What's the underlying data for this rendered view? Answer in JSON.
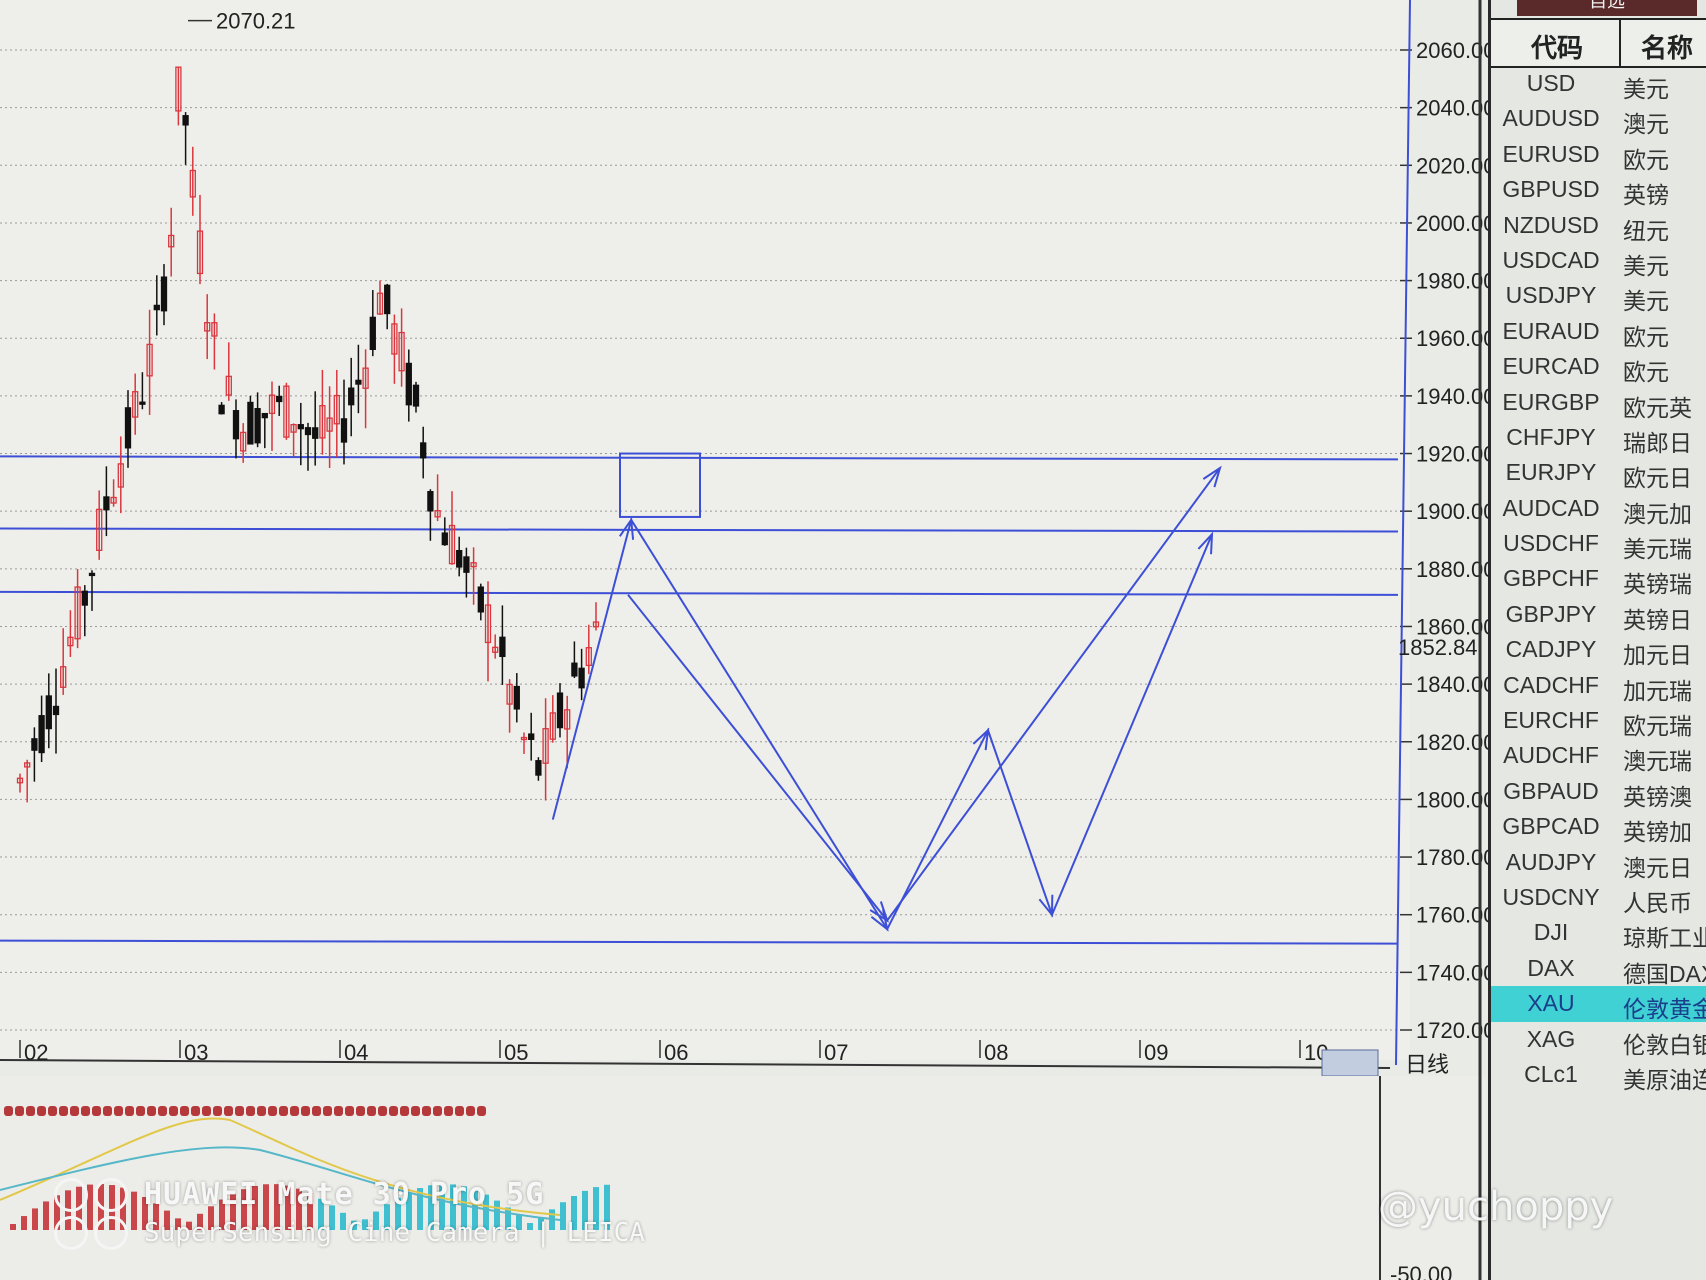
{
  "chart": {
    "peak_label": "2070.21",
    "current_price": "1852.84",
    "period_label": "日线",
    "colors": {
      "up": "#d9363e",
      "down": "#111111",
      "lines": "#3d4fd6",
      "price": "#e07070"
    }
  },
  "chart_data": {
    "type": "candlestick",
    "y_ticks": [
      "2060.00",
      "2040.00",
      "2020.00",
      "2000.00",
      "1980.00",
      "1960.00",
      "1940.00",
      "1920.00",
      "1900.00",
      "1880.00",
      "1860.00",
      "1840.00",
      "1820.00",
      "1800.00",
      "1780.00",
      "1760.00",
      "1740.00",
      "1720.00"
    ],
    "x_ticks": [
      "02",
      "03",
      "04",
      "05",
      "06",
      "07",
      "08",
      "09",
      "10"
    ],
    "ylim": [
      1720,
      2060
    ],
    "horizontal_levels": [
      1919,
      1894,
      1872,
      1751
    ],
    "peak": 2070.21,
    "current": 1852.84,
    "forecast_path_a": [
      [
        5.33,
        1793
      ],
      [
        5.82,
        1897
      ],
      [
        7.42,
        1755
      ],
      [
        8.05,
        1824
      ],
      [
        8.45,
        1760
      ],
      [
        9.45,
        1892
      ]
    ],
    "forecast_path_b": [
      [
        5.8,
        1871
      ],
      [
        7.42,
        1758
      ],
      [
        9.5,
        1915
      ]
    ],
    "target_box": {
      "x": [
        5.75,
        6.25
      ],
      "y": [
        1898,
        1920
      ]
    },
    "lower_indicator_value": "-50.00"
  },
  "watchlist": {
    "tab": "自选",
    "headers": {
      "code": "代码",
      "name": "名称"
    },
    "rows": [
      {
        "code": "USD",
        "name": "美元"
      },
      {
        "code": "AUDUSD",
        "name": "澳元"
      },
      {
        "code": "EURUSD",
        "name": "欧元"
      },
      {
        "code": "GBPUSD",
        "name": "英镑"
      },
      {
        "code": "NZDUSD",
        "name": "纽元"
      },
      {
        "code": "USDCAD",
        "name": "美元"
      },
      {
        "code": "USDJPY",
        "name": "美元"
      },
      {
        "code": "EURAUD",
        "name": "欧元"
      },
      {
        "code": "EURCAD",
        "name": "欧元"
      },
      {
        "code": "EURGBP",
        "name": "欧元英"
      },
      {
        "code": "CHFJPY",
        "name": "瑞郎日"
      },
      {
        "code": "EURJPY",
        "name": "欧元日"
      },
      {
        "code": "AUDCAD",
        "name": "澳元加"
      },
      {
        "code": "USDCHF",
        "name": "美元瑞"
      },
      {
        "code": "GBPCHF",
        "name": "英镑瑞"
      },
      {
        "code": "GBPJPY",
        "name": "英镑日"
      },
      {
        "code": "CADJPY",
        "name": "加元日"
      },
      {
        "code": "CADCHF",
        "name": "加元瑞"
      },
      {
        "code": "EURCHF",
        "name": "欧元瑞"
      },
      {
        "code": "AUDCHF",
        "name": "澳元瑞"
      },
      {
        "code": "GBPAUD",
        "name": "英镑澳"
      },
      {
        "code": "GBPCAD",
        "name": "英镑加"
      },
      {
        "code": "AUDJPY",
        "name": "澳元日"
      },
      {
        "code": "USDCNY",
        "name": "人民币"
      },
      {
        "code": "DJI",
        "name": "琼斯工业"
      },
      {
        "code": "DAX",
        "name": "德国DAX"
      },
      {
        "code": "XAU",
        "name": "伦敦黄金",
        "selected": true
      },
      {
        "code": "XAG",
        "name": "伦敦白银"
      },
      {
        "code": "CLc1",
        "name": "美原油连"
      }
    ]
  },
  "watermark": {
    "line1": "HUAWEI Mate 30 Pro 5G",
    "line2": "SuperSensing Cine Camera | LEICA",
    "signature": "@yuchoppy"
  }
}
